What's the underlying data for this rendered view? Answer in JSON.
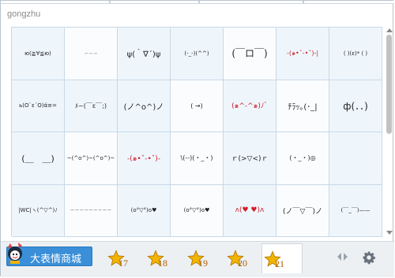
{
  "panel": {
    "title": "gongzhu"
  },
  "emoticons": [
    [
      "ю(≧∀≦ю)",
      "∽∽∽",
      "ψ(｀∇´)ψ",
      "(-_-)(^^)",
      "(￣ロ￣)",
      "-(๑•ˇ-•ˇ)-|",
      "( )(ε)*   ( )"
    ],
    [
      "ь(O`ε´O)ά≡=",
      "ﾒ~(￣ε￣;)",
      "(ノ^o^)ノ",
      "( →)",
      "(๑^-^๑)ﾉﾞ",
      "ﾁﾗｯ｡(･_|",
      "ф(．．)"
    ],
    [
      "(＿　＿)",
      "~(^o^)~(^o^)~",
      "-(๑•ˇ-•ˇ)-",
      "\\(--)(・_・)",
      "ｒ(>▽<)ｒ",
      "(・_・)◎",
      ""
    ],
    [
      "|WC|ヽ(^▽^)ﾉ",
      "~~~~~~~~~",
      "(o°▽°)o♥",
      "(o°▽°)o♥",
      "ʌ(♥ ♥)ʌ",
      "(ノ￣▽￣)ノ",
      "(￣_￣)——"
    ]
  ],
  "store": {
    "label": "大表情商城"
  },
  "tabs": [
    {
      "num": "17",
      "active": false
    },
    {
      "num": "18",
      "active": false
    },
    {
      "num": "19",
      "active": false
    },
    {
      "num": "20",
      "active": false
    },
    {
      "num": "21",
      "active": true
    }
  ],
  "colors": {
    "accent": "#3a8fd8",
    "cell_bg": "#eef6fc",
    "grid_line": "#c9d8e6",
    "star": "#f2b400",
    "heart": "#d0202a"
  },
  "icons": {
    "nav_prev": "chevron-left-icon",
    "nav_next": "chevron-right-icon",
    "settings": "gear-icon",
    "tab": "star-icon",
    "store": "mascot-icon"
  }
}
